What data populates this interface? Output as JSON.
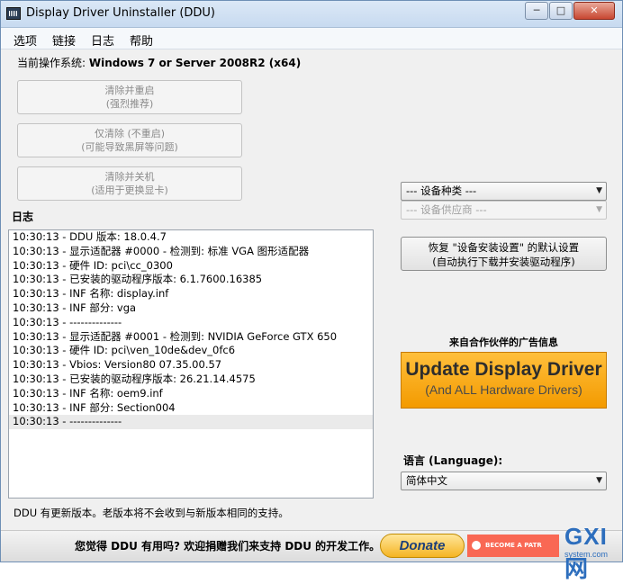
{
  "window": {
    "title": "Display Driver Uninstaller (DDU)",
    "min": "─",
    "max": "□",
    "close": "✕"
  },
  "menu": [
    "选项",
    "链接",
    "日志",
    "帮助"
  ],
  "os": {
    "label": "当前操作系统:",
    "value": "Windows 7 or Server 2008R2 (x64)"
  },
  "buttons": [
    {
      "line1": "清除并重启",
      "line2": "(强烈推荐)"
    },
    {
      "line1": "仅清除 (不重启)",
      "line2": "(可能导致黑屏等问题)"
    },
    {
      "line1": "清除并关机",
      "line2": "(适用于更换显卡)"
    }
  ],
  "log": {
    "label": "日志",
    "lines": [
      "10:30:13 - DDU 版本: 18.0.4.7",
      "10:30:13 - 显示适配器 #0000 - 检测到: 标准 VGA 图形适配器",
      "10:30:13 - 硬件 ID: pci\\cc_0300",
      "10:30:13 - 已安装的驱动程序版本: 6.1.7600.16385",
      "10:30:13 - INF 名称: display.inf",
      "10:30:13 - INF 部分: vga",
      "10:30:13 - --------------",
      "10:30:13 - 显示适配器 #0001 - 检测到: NVIDIA GeForce GTX 650",
      "10:30:13 - 硬件 ID: pci\\ven_10de&dev_0fc6",
      "10:30:13 - Vbios: Version80 07.35.00.57",
      "10:30:13 - 已安装的驱动程序版本: 26.21.14.4575",
      "10:30:13 - INF 名称: oem9.inf",
      "10:30:13 - INF 部分: Section004",
      "10:30:13 - --------------"
    ]
  },
  "device_type": "--- 设备种类 ---",
  "device_vendor": "--- 设备供应商 ---",
  "restore": {
    "line1": "恢复 \"设备安装设置\" 的默认设置",
    "line2": "(自动执行下载并安装驱动程序)"
  },
  "ad": {
    "title": "来自合作伙伴的广告信息",
    "line1": "Update Display Driver",
    "line2": "(And ALL Hardware Drivers)"
  },
  "language": {
    "label": "语言 (Language):",
    "value": "简体中文"
  },
  "status": "DDU 有更新版本。老版本将不会收到与新版本相同的支持。",
  "footer": {
    "text": "您觉得 DDU 有用吗? 欢迎捐赠我们来支持 DDU 的开发工作。",
    "donate": "Donate",
    "patreon": "BECOME A PATR"
  },
  "watermark": {
    "main": "GXI网",
    "sub": "system.com"
  }
}
